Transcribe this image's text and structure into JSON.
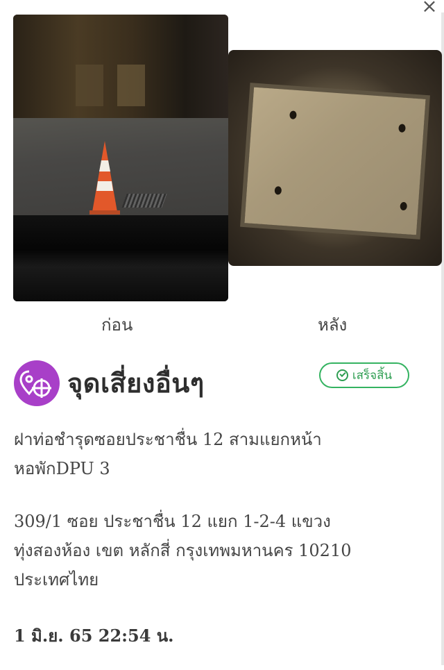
{
  "close_label": "×",
  "photos": {
    "before_caption": "ก่อน",
    "after_caption": "หลัง"
  },
  "category": {
    "title": "จุดเสี่ยงอื่นๆ",
    "icon": "map-pin-crosshair-icon",
    "icon_color": "#a83fc8"
  },
  "status": {
    "label": "เสร็จสิ้น",
    "icon": "check-circle-icon",
    "color": "#34b361"
  },
  "description": {
    "line1": "ฝาท่อชำรุดซอยประชาชื่น 12 สามแยกหน้า",
    "line2": "หอพักDPU 3"
  },
  "address": {
    "line1": "309/1 ซอย ประชาชื่น 12 แยก 1-2-4 แขวง",
    "line2": "ทุ่งสองห้อง เขต หลักสี่ กรุงเทพมหานคร 10210",
    "line3": "ประเทศไทย"
  },
  "timestamp": "1 มิ.ย. 65 22:54 น."
}
